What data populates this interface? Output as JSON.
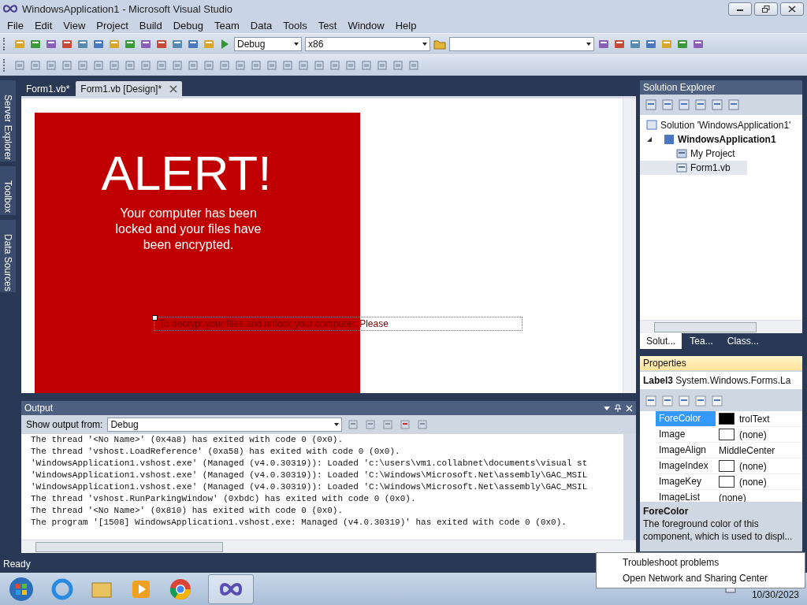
{
  "window": {
    "title": "WindowsApplication1 - Microsoft Visual Studio"
  },
  "menu": [
    "File",
    "Edit",
    "View",
    "Project",
    "Build",
    "Debug",
    "Team",
    "Data",
    "Tools",
    "Test",
    "Window",
    "Help"
  ],
  "toolbar": {
    "configuration": "Debug",
    "platform": "x86"
  },
  "side_tabs": [
    "Server Explorer",
    "Toolbox",
    "Data Sources"
  ],
  "doc_tabs": [
    {
      "label": "Form1.vb*",
      "selected": false
    },
    {
      "label": "Form1.vb [Design]*",
      "selected": true
    }
  ],
  "designer": {
    "alert_title": "ALERT!",
    "alert_message": "Your computer has been locked and your files have been encrypted.",
    "label_text": "To decrypt your files and unlock your computer. Please"
  },
  "output": {
    "title": "Output",
    "source_label": "Show output from:",
    "source": "Debug",
    "lines": [
      "The thread '<No Name>' (0x4a8) has exited with code 0 (0x0).",
      "The thread 'vshost.LoadReference' (0xa58) has exited with code 0 (0x0).",
      "'WindowsApplication1.vshost.exe' (Managed (v4.0.30319)): Loaded 'c:\\users\\vm1.collabnet\\documents\\visual st",
      "'WindowsApplication1.vshost.exe' (Managed (v4.0.30319)): Loaded 'C:\\Windows\\Microsoft.Net\\assembly\\GAC_MSIL",
      "'WindowsApplication1.vshost.exe' (Managed (v4.0.30319)): Loaded 'C:\\Windows\\Microsoft.Net\\assembly\\GAC_MSIL",
      "The thread 'vshost.RunParkingWindow' (0xbdc) has exited with code 0 (0x0).",
      "The thread '<No Name>' (0x810) has exited with code 0 (0x0).",
      "The program '[1508] WindowsApplication1.vshost.exe: Managed (v4.0.30319)' has exited with code 0 (0x0)."
    ]
  },
  "solution_explorer": {
    "title": "Solution Explorer",
    "tree": [
      {
        "label": "Solution 'WindowsApplication1'",
        "kind": "solution",
        "selected": false,
        "children": [
          {
            "label": "WindowsApplication1",
            "kind": "project",
            "selected": false,
            "expanded": true,
            "children": [
              {
                "label": "My Project",
                "kind": "folder",
                "selected": false
              },
              {
                "label": "Form1.vb",
                "kind": "form",
                "selected": true
              }
            ]
          }
        ]
      }
    ],
    "tabs": [
      {
        "label": "Solut...",
        "selected": true
      },
      {
        "label": "Tea...",
        "selected": false
      },
      {
        "label": "Class...",
        "selected": false
      }
    ]
  },
  "properties": {
    "title": "Properties",
    "object_name": "Label3",
    "object_type": "System.Windows.Forms.La",
    "rows": [
      {
        "name": "ForeColor",
        "value": "trolText",
        "kind": "swatch",
        "color": "#000000",
        "selected": true
      },
      {
        "name": "Image",
        "value": "(none)",
        "kind": "swatch",
        "color": "#ffffff",
        "selected": false
      },
      {
        "name": "ImageAlign",
        "value": "MiddleCenter",
        "kind": "text",
        "selected": false
      },
      {
        "name": "ImageIndex",
        "value": "(none)",
        "kind": "swatch",
        "color": "#ffffff",
        "selected": false
      },
      {
        "name": "ImageKey",
        "value": "(none)",
        "kind": "swatch",
        "color": "#ffffff",
        "selected": false
      },
      {
        "name": "ImageList",
        "value": "(none)",
        "kind": "text",
        "selected": false
      }
    ],
    "description_title": "ForeColor",
    "description": "The foreground color of this component, which is used to displ..."
  },
  "status_bar": {
    "text": "Ready"
  },
  "taskbar": {
    "date": "10/30/2023"
  },
  "context_menu": [
    "Troubleshoot problems",
    "Open Network and Sharing Center"
  ]
}
